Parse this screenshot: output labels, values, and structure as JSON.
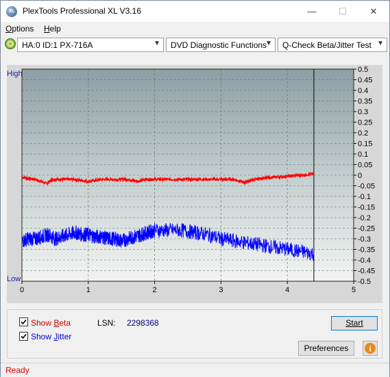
{
  "window": {
    "title": "PlexTools Professional XL V3.16",
    "minimize": "—",
    "maximize": "☐",
    "close": "✕"
  },
  "menu": [
    {
      "label": "Options",
      "key": "O",
      "rest": "ptions"
    },
    {
      "label": "Help",
      "key": "H",
      "rest": "elp"
    }
  ],
  "toolbar": {
    "drive": "HA:0 ID:1  PX-716A",
    "function": "DVD Diagnostic Functions",
    "test": "Q-Check Beta/Jitter Test"
  },
  "chart_data": {
    "type": "line",
    "x_ticks": [
      "0",
      "1",
      "2",
      "3",
      "4",
      "5"
    ],
    "xlim": [
      0,
      5
    ],
    "y_left_labels": {
      "top": "High",
      "bottom": "Low"
    },
    "y_right_ticks": [
      "0.5",
      "0.45",
      "0.4",
      "0.35",
      "0.3",
      "0.25",
      "0.2",
      "0.15",
      "0.1",
      "0.05",
      "0",
      "-0.05",
      "-0.1",
      "-0.15",
      "-0.2",
      "-0.25",
      "-0.3",
      "-0.35",
      "-0.4",
      "-0.45",
      "-0.5"
    ],
    "ylim": [
      -0.5,
      0.5
    ],
    "end_marker_x": 4.4,
    "grid": true,
    "series": [
      {
        "color": "#ff0000",
        "x": [
          0,
          0.2,
          0.38,
          0.45,
          0.6,
          0.8,
          1.0,
          1.2,
          1.4,
          1.6,
          1.75,
          1.85,
          2.0,
          2.2,
          2.4,
          2.6,
          2.8,
          3.0,
          3.2,
          3.35,
          3.45,
          3.6,
          3.8,
          4.0,
          4.2,
          4.4
        ],
        "y": [
          -0.01,
          -0.02,
          -0.04,
          -0.02,
          -0.02,
          -0.02,
          -0.03,
          -0.02,
          -0.02,
          -0.02,
          -0.03,
          -0.02,
          -0.02,
          -0.02,
          -0.02,
          -0.02,
          -0.02,
          -0.02,
          -0.02,
          -0.035,
          -0.025,
          -0.015,
          -0.01,
          -0.005,
          0.0,
          0.005
        ]
      },
      {
        "color": "#0000ff",
        "x": [
          0,
          0.1,
          0.2,
          0.3,
          0.4,
          0.5,
          0.6,
          0.7,
          0.8,
          0.9,
          1.0,
          1.1,
          1.2,
          1.3,
          1.4,
          1.5,
          1.6,
          1.7,
          1.8,
          1.9,
          2.0,
          2.2,
          2.4,
          2.6,
          2.8,
          3.0,
          3.2,
          3.4,
          3.6,
          3.8,
          4.0,
          4.2,
          4.4
        ],
        "y": [
          -0.31,
          -0.3,
          -0.3,
          -0.29,
          -0.28,
          -0.3,
          -0.29,
          -0.28,
          -0.27,
          -0.28,
          -0.28,
          -0.29,
          -0.29,
          -0.3,
          -0.3,
          -0.31,
          -0.3,
          -0.29,
          -0.28,
          -0.27,
          -0.26,
          -0.26,
          -0.26,
          -0.27,
          -0.28,
          -0.3,
          -0.31,
          -0.32,
          -0.33,
          -0.34,
          -0.35,
          -0.36,
          -0.37
        ]
      }
    ]
  },
  "options": {
    "show_beta": "Show Beta",
    "show_beta_key": "B",
    "show_jitter": "Show Jitter",
    "show_jitter_key": "J",
    "lsn_label": "LSN:",
    "lsn_value": "2298368",
    "beta_color": "#cc0000",
    "jitter_color": "#0000cc"
  },
  "buttons": {
    "start": "Start",
    "preferences": "Preferences",
    "info": "i"
  },
  "status": "Ready"
}
